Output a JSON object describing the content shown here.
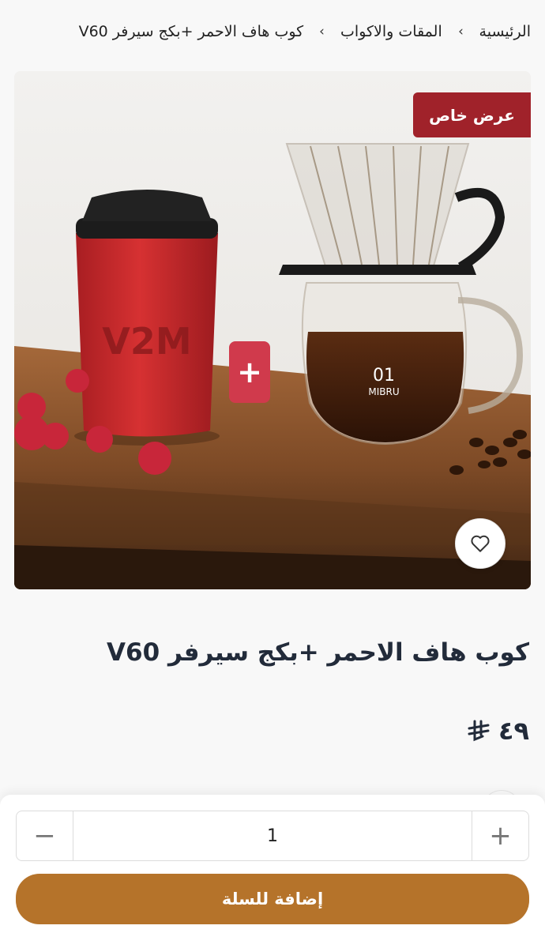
{
  "breadcrumb": {
    "home": "الرئيسية",
    "category": "المقات والاكواب",
    "current": "كوب هاف الاحمر +بكج سيرفر V60",
    "separator": "‹"
  },
  "product": {
    "badge": "عرض خاص",
    "plus_symbol": "+",
    "cup_brand": "V2M",
    "server_label_number": "01",
    "server_label_brand": "MIBRU",
    "title": "كوب هاف الاحمر +بكج سيرفر V60",
    "price": "٤٩",
    "currency_icon": "riyal-icon"
  },
  "cart": {
    "quantity": "1",
    "minus_symbol": "−",
    "plus_symbol": "+",
    "add_label": "إضافة للسلة"
  },
  "colors": {
    "badge": "#a0222a",
    "plus_badge": "#d03a4c",
    "cart_button": "#b5732a",
    "cup_red": "#c4272a"
  }
}
